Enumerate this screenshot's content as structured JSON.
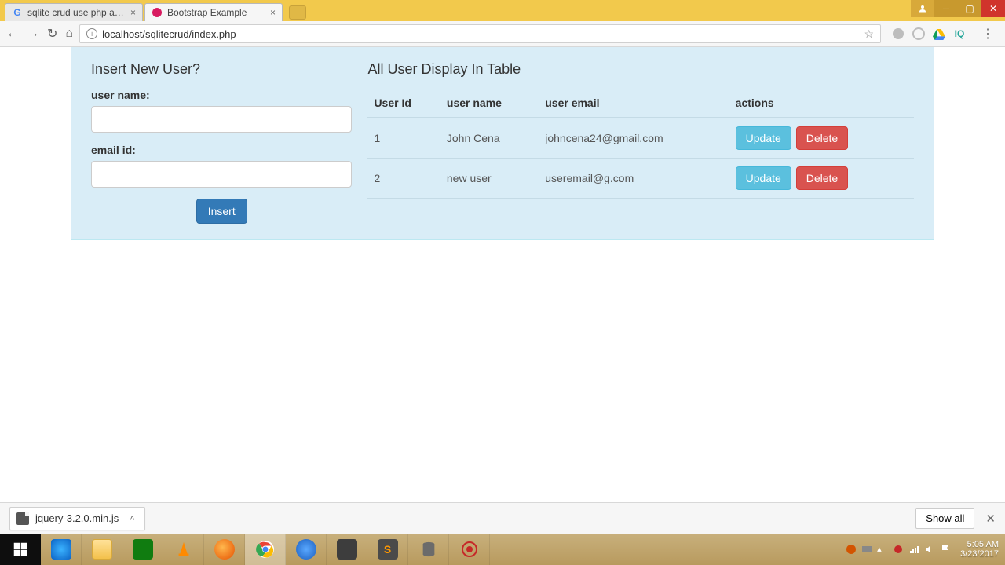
{
  "browser": {
    "tabs": [
      {
        "title": "sqlite crud use php and l",
        "active": false
      },
      {
        "title": "Bootstrap Example",
        "active": true
      }
    ],
    "url": "localhost/sqlitecrud/index.php"
  },
  "page": {
    "form": {
      "heading": "Insert New User?",
      "username_label": "user name:",
      "username_value": "",
      "email_label": "email id:",
      "email_value": "",
      "submit_label": "Insert"
    },
    "table": {
      "heading": "All User Display In Table",
      "columns": {
        "id": "User Id",
        "name": "user name",
        "email": "user email",
        "actions": "actions"
      },
      "rows": [
        {
          "id": "1",
          "name": "John Cena",
          "email": "johncena24@gmail.com"
        },
        {
          "id": "2",
          "name": "new user",
          "email": "useremail@g.com"
        }
      ],
      "update_label": "Update",
      "delete_label": "Delete"
    }
  },
  "download_bar": {
    "file": "jquery-3.2.0.min.js",
    "show_all": "Show all"
  },
  "system": {
    "time": "5:05 AM",
    "date": "3/23/2017"
  }
}
